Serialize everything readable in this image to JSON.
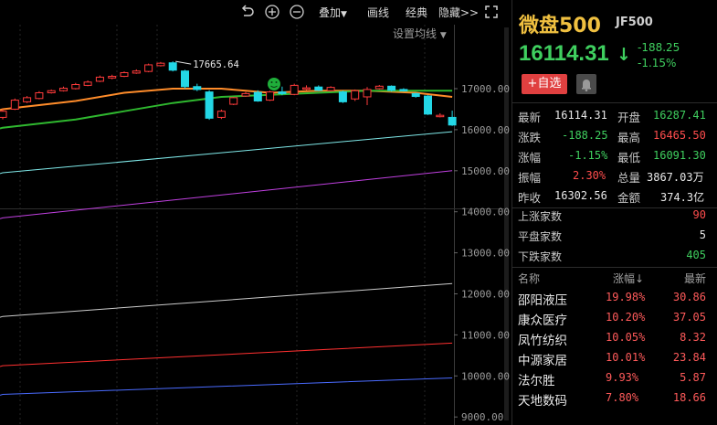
{
  "toolbar": {
    "overlay_label": "叠加",
    "draw_label": "画线",
    "classic_label": "经典",
    "hide_label": "隐藏>>"
  },
  "ma_setting_label": "设置均线",
  "chart_data": {
    "type": "candlestick",
    "price_axis_labels": [
      "17000.00",
      "16000.00",
      "15000.00",
      "14000.00",
      "13000.00",
      "12000.00",
      "11000.00",
      "10000.00",
      "9000.00"
    ],
    "high_annotation": "17665.64",
    "candles": [
      {
        "o": 16300,
        "c": 16450,
        "h": 16500,
        "l": 16250
      },
      {
        "o": 16500,
        "c": 16720,
        "h": 16760,
        "l": 16480
      },
      {
        "o": 16680,
        "c": 16780,
        "h": 16820,
        "l": 16650
      },
      {
        "o": 16760,
        "c": 16900,
        "h": 16940,
        "l": 16740
      },
      {
        "o": 16900,
        "c": 16950,
        "h": 16980,
        "l": 16880
      },
      {
        "o": 16950,
        "c": 17010,
        "h": 17050,
        "l": 16930
      },
      {
        "o": 17000,
        "c": 17100,
        "h": 17140,
        "l": 16980
      },
      {
        "o": 17080,
        "c": 17160,
        "h": 17200,
        "l": 17060
      },
      {
        "o": 17180,
        "c": 17280,
        "h": 17320,
        "l": 17160
      },
      {
        "o": 17260,
        "c": 17300,
        "h": 17340,
        "l": 17230
      },
      {
        "o": 17300,
        "c": 17390,
        "h": 17420,
        "l": 17280
      },
      {
        "o": 17380,
        "c": 17430,
        "h": 17470,
        "l": 17360
      },
      {
        "o": 17420,
        "c": 17580,
        "h": 17610,
        "l": 17400
      },
      {
        "o": 17560,
        "c": 17620,
        "h": 17650,
        "l": 17540
      },
      {
        "o": 17630,
        "c": 17450,
        "h": 17665,
        "l": 17420
      },
      {
        "o": 17430,
        "c": 17050,
        "h": 17460,
        "l": 17000
      },
      {
        "o": 17050,
        "c": 16980,
        "h": 17120,
        "l": 16940
      },
      {
        "o": 16920,
        "c": 16280,
        "h": 16960,
        "l": 16240
      },
      {
        "o": 16300,
        "c": 16450,
        "h": 16490,
        "l": 16260
      },
      {
        "o": 16620,
        "c": 16780,
        "h": 16800,
        "l": 16600
      },
      {
        "o": 16820,
        "c": 16880,
        "h": 16920,
        "l": 16800
      },
      {
        "o": 16910,
        "c": 16700,
        "h": 16960,
        "l": 16680
      },
      {
        "o": 16720,
        "c": 16920,
        "h": 16950,
        "l": 16700
      },
      {
        "o": 16920,
        "c": 16880,
        "h": 17050,
        "l": 16840
      },
      {
        "o": 16860,
        "c": 17080,
        "h": 17120,
        "l": 16840
      },
      {
        "o": 17000,
        "c": 17020,
        "h": 17080,
        "l": 16960
      },
      {
        "o": 17040,
        "c": 16960,
        "h": 17080,
        "l": 16940
      },
      {
        "o": 16950,
        "c": 17030,
        "h": 17060,
        "l": 16930
      },
      {
        "o": 16920,
        "c": 16680,
        "h": 16950,
        "l": 16650
      },
      {
        "o": 16750,
        "c": 16950,
        "h": 16980,
        "l": 16700
      },
      {
        "o": 16800,
        "c": 16980,
        "h": 17040,
        "l": 16600
      },
      {
        "o": 17000,
        "c": 17060,
        "h": 17090,
        "l": 16980
      },
      {
        "o": 17060,
        "c": 16960,
        "h": 17080,
        "l": 16930
      },
      {
        "o": 16980,
        "c": 16950,
        "h": 17010,
        "l": 16930
      },
      {
        "o": 16880,
        "c": 16810,
        "h": 16900,
        "l": 16780
      },
      {
        "o": 16820,
        "c": 16380,
        "h": 16840,
        "l": 16360
      },
      {
        "o": 16320,
        "c": 16350,
        "h": 16400,
        "l": 16300
      },
      {
        "o": 16300,
        "c": 16114,
        "h": 16465,
        "l": 16091
      }
    ],
    "ma_lines": [
      {
        "color": "#ff8c2a",
        "points": [
          [
            0,
            16500
          ],
          [
            6,
            16700
          ],
          [
            10,
            16900
          ],
          [
            14,
            17000
          ],
          [
            18,
            17000
          ],
          [
            22,
            16900
          ],
          [
            26,
            16950
          ],
          [
            30,
            16950
          ],
          [
            34,
            16900
          ],
          [
            37,
            16800
          ]
        ]
      },
      {
        "color": "#2fb82f",
        "points": [
          [
            0,
            16050
          ],
          [
            6,
            16250
          ],
          [
            10,
            16450
          ],
          [
            14,
            16650
          ],
          [
            18,
            16800
          ],
          [
            22,
            16850
          ],
          [
            26,
            16900
          ],
          [
            30,
            16950
          ],
          [
            34,
            16950
          ],
          [
            37,
            16950
          ]
        ]
      },
      {
        "color": "#7fe8e8",
        "points": [
          [
            0,
            14950
          ],
          [
            37,
            15950
          ]
        ]
      },
      {
        "color": "#c040e0",
        "points": [
          [
            0,
            13850
          ],
          [
            37,
            15000
          ]
        ]
      },
      {
        "color": "#cccccc",
        "points": [
          [
            0,
            11450
          ],
          [
            37,
            12250
          ]
        ]
      },
      {
        "color": "#ff3030",
        "points": [
          [
            0,
            10250
          ],
          [
            37,
            10800
          ]
        ]
      },
      {
        "color": "#4a6bff",
        "points": [
          [
            0,
            9550
          ],
          [
            37,
            9950
          ]
        ]
      }
    ]
  },
  "quote": {
    "name": "微盘500",
    "code": "JF500",
    "price": "16114.31",
    "change": "-188.25",
    "change_pct": "-1.15%",
    "add_label": "+自选"
  },
  "stats": {
    "latest_label": "最新",
    "latest": "16114.31",
    "open_label": "开盘",
    "open": "16287.41",
    "change_label": "涨跌",
    "change": "-188.25",
    "high_label": "最高",
    "high": "16465.50",
    "pct_label": "涨幅",
    "pct": "-1.15%",
    "low_label": "最低",
    "low": "16091.30",
    "amp_label": "振幅",
    "amp": "2.30%",
    "volume_label": "总量",
    "volume": "3867.03万",
    "prev_label": "昨收",
    "prev": "16302.56",
    "amount_label": "金额",
    "amount": "374.3亿"
  },
  "breadth": {
    "up_label": "上涨家数",
    "up": "90",
    "flat_label": "平盘家数",
    "flat": "5",
    "down_label": "下跌家数",
    "down": "405"
  },
  "list": {
    "col_name": "名称",
    "col_pct": "涨幅↓",
    "col_last": "最新",
    "rows": [
      {
        "name": "邵阳液压",
        "pct": "19.98%",
        "last": "30.86"
      },
      {
        "name": "康众医疗",
        "pct": "10.20%",
        "last": "37.05"
      },
      {
        "name": "凤竹纺织",
        "pct": "10.05%",
        "last": "8.32"
      },
      {
        "name": "中源家居",
        "pct": "10.01%",
        "last": "23.84"
      },
      {
        "name": "法尔胜",
        "pct": "9.93%",
        "last": "5.87"
      },
      {
        "name": "天地数码",
        "pct": "7.80%",
        "last": "18.66"
      }
    ]
  }
}
